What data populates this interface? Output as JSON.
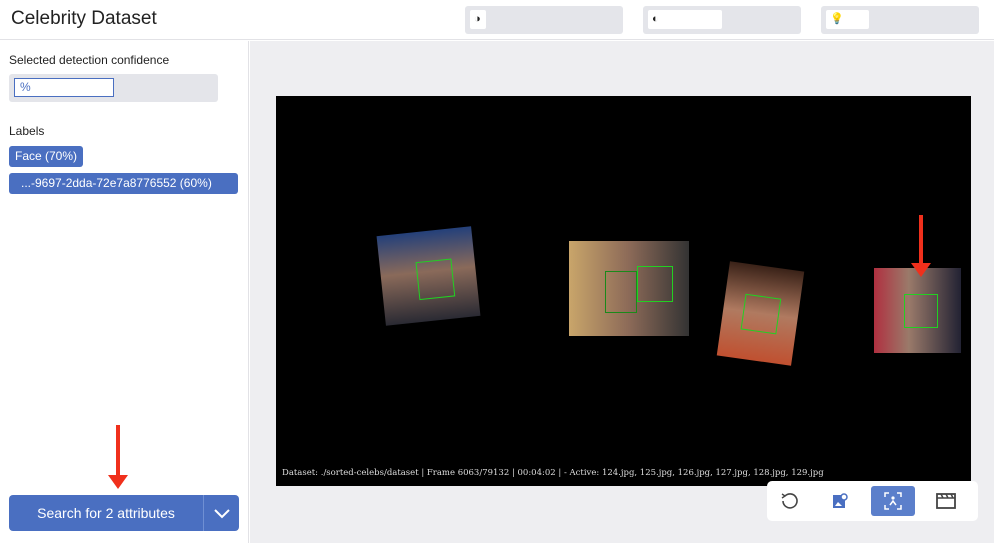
{
  "header": {
    "title": "Celebrity Dataset",
    "tools": [
      {
        "icon": "brightness-icon"
      },
      {
        "icon": "contrast-icon"
      },
      {
        "icon": "lightbulb-icon"
      }
    ]
  },
  "sidebar": {
    "confidence_label": "Selected detection confidence",
    "confidence_value": "%",
    "labels_heading": "Labels",
    "labels": [
      "Face (70%)",
      "...-9697-2dda-72e7a8776552 (60%)"
    ],
    "search_button": "Search for 2 attributes"
  },
  "viewer": {
    "status": "Dataset: ./sorted-celebs/dataset | Frame 6063/79132 | 00:04:02 | - Active: 124.jpg, 125.jpg, 126.jpg, 127.jpg, 128.jpg, 129.jpg",
    "toolbar": [
      {
        "icon": "reset-icon"
      },
      {
        "icon": "image-search-icon"
      },
      {
        "icon": "face-detect-icon",
        "active": true
      },
      {
        "icon": "clapperboard-icon"
      }
    ]
  },
  "colors": {
    "accent": "#4a6fc1",
    "detection": "#22d022",
    "annotation": "#f0301c"
  }
}
